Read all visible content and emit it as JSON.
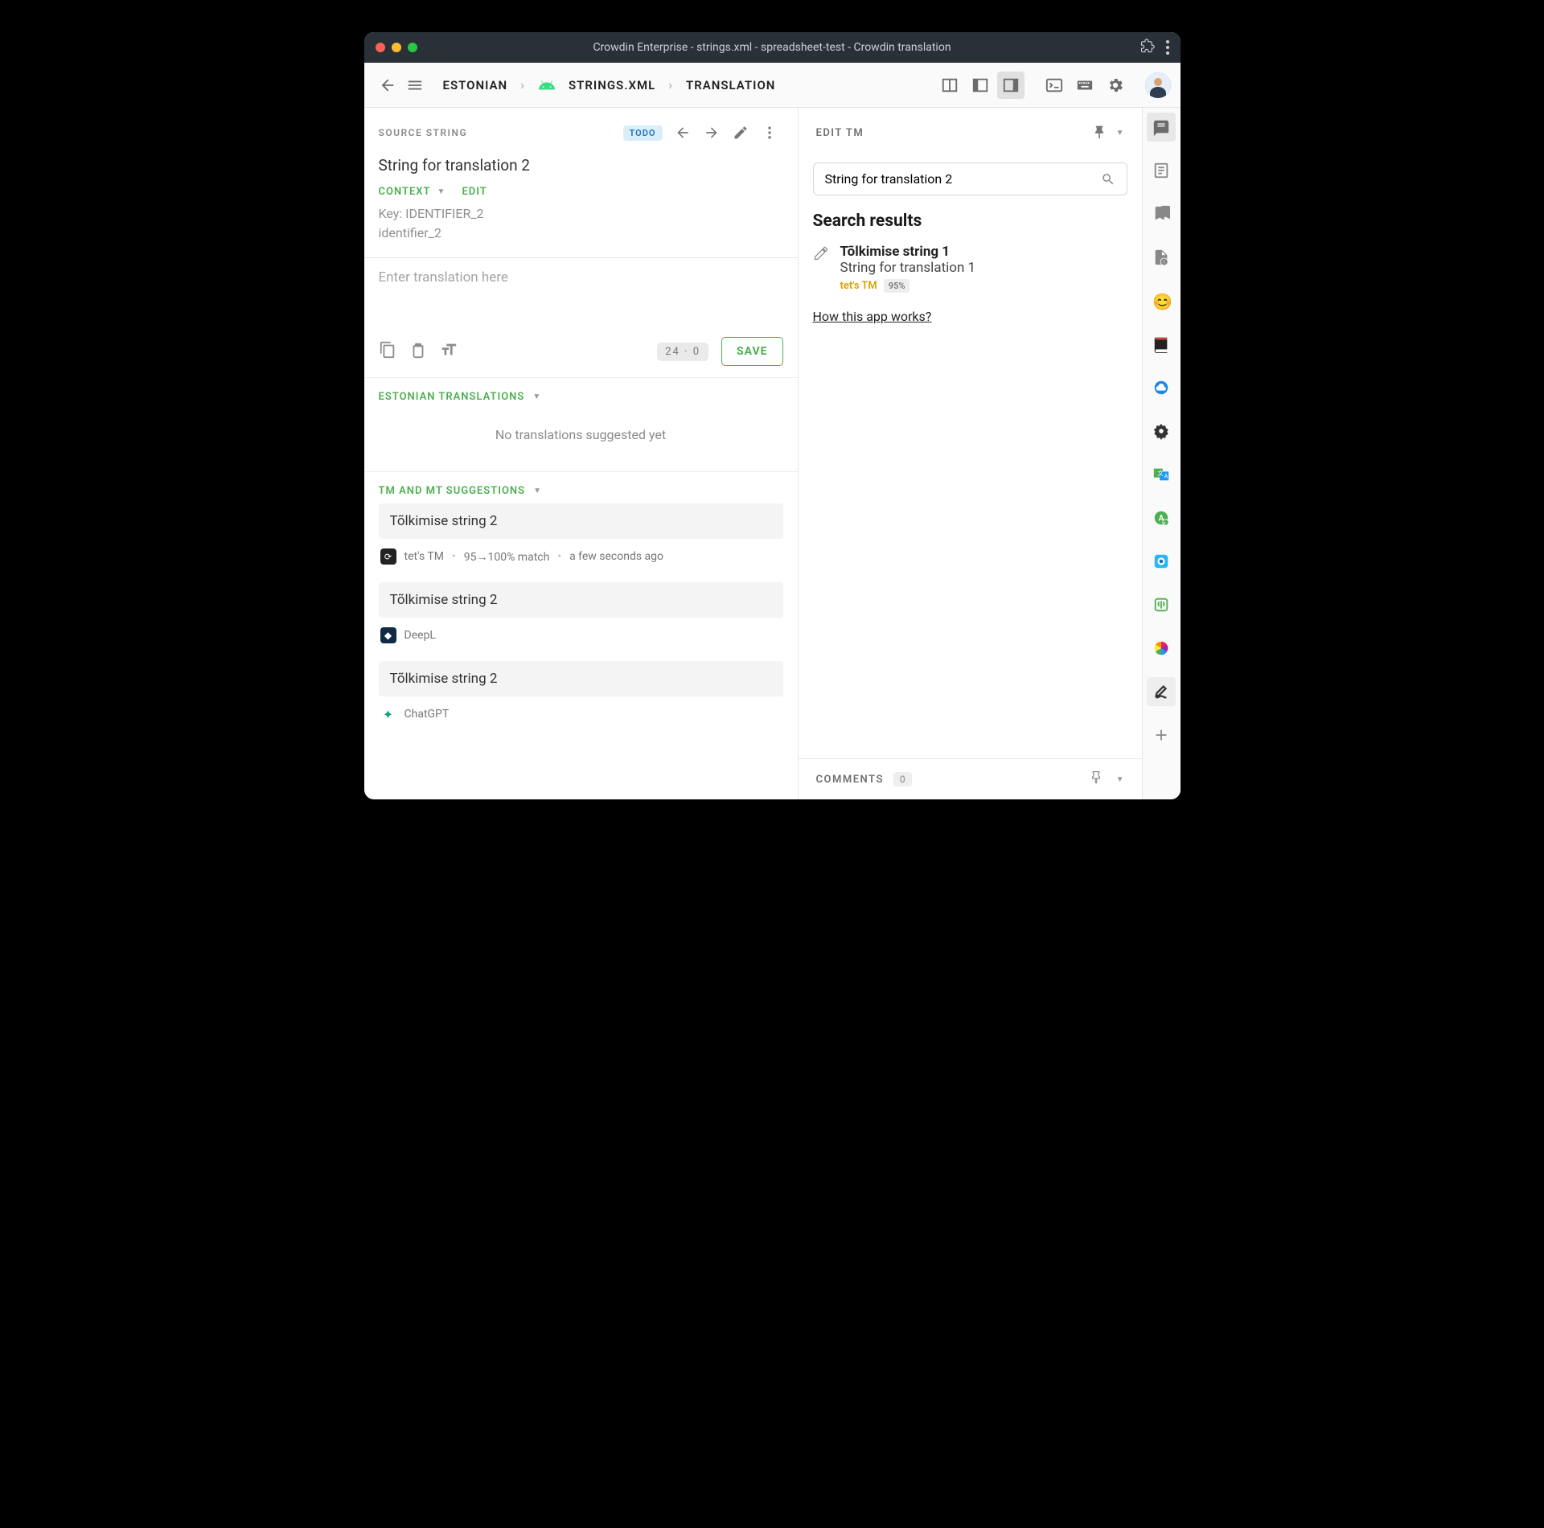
{
  "window_title": "Crowdin Enterprise - strings.xml - spreadsheet-test - Crowdin translation",
  "breadcrumb": {
    "lang": "ESTONIAN",
    "file": "STRINGS.XML",
    "mode": "TRANSLATION"
  },
  "source": {
    "section": "SOURCE STRING",
    "badge": "TODO",
    "text": "String for translation 2",
    "context_btn": "CONTEXT",
    "edit_btn": "EDIT",
    "key_line": "Key: IDENTIFIER_2",
    "identifier": "identifier_2"
  },
  "translation": {
    "placeholder": "Enter translation here",
    "count": "24 · 0",
    "save": "SAVE"
  },
  "est_section": {
    "title": "ESTONIAN TRANSLATIONS",
    "empty": "No translations suggested yet"
  },
  "sugg_section": {
    "title": "TM AND MT SUGGESTIONS"
  },
  "suggestions": [
    {
      "text": "Tõlkimise string 2",
      "provider": "tet's TM",
      "match": "95→100% match",
      "time": "a few seconds ago",
      "icon": "tm"
    },
    {
      "text": "Tõlkimise string 2",
      "provider": "DeepL",
      "icon": "deepl"
    },
    {
      "text": "Tõlkimise string 2",
      "provider": "ChatGPT",
      "icon": "chatgpt"
    }
  ],
  "panel": {
    "title": "EDIT TM",
    "search": "String for translation 2",
    "results_title": "Search results",
    "result": {
      "title": "Tõlkimise string 1",
      "sub": "String for translation 1",
      "tm": "tet's TM",
      "pct": "95%"
    },
    "howlink": "How this app works?"
  },
  "comments": {
    "label": "COMMENTS",
    "count": "0"
  }
}
